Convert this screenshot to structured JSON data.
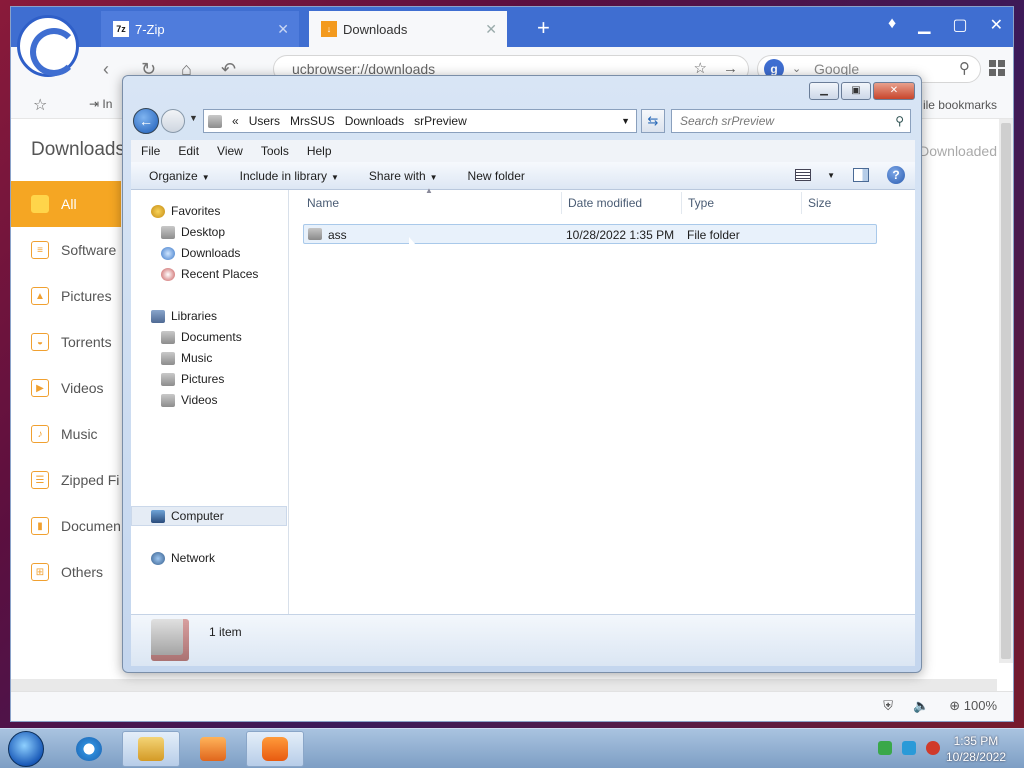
{
  "browser": {
    "tabs": [
      {
        "label": "7-Zip",
        "icon": "7zip-icon",
        "badge": "7z"
      },
      {
        "label": "Downloads",
        "icon": "download-icon"
      }
    ],
    "address": "ucbrowser://downloads",
    "search_placeholder": "Google",
    "bookmark_import_fragment": "In",
    "bookmark_mobile_fragment": "ile bookmarks",
    "page_title": "Downloads",
    "right_header_fragment": "Downloaded",
    "sidebar": [
      {
        "label": "All",
        "active": true
      },
      {
        "label": "Software"
      },
      {
        "label": "Pictures"
      },
      {
        "label": "Torrents"
      },
      {
        "label": "Videos"
      },
      {
        "label": "Music"
      },
      {
        "label": "Zipped Fi"
      },
      {
        "label": "Documen"
      },
      {
        "label": "Others"
      }
    ],
    "zoom": "100%"
  },
  "explorer": {
    "breadcrumb": [
      "«",
      "Users",
      "MrsSUS",
      "Downloads",
      "srPreview"
    ],
    "search_placeholder": "Search srPreview",
    "menu": [
      "File",
      "Edit",
      "View",
      "Tools",
      "Help"
    ],
    "commands": [
      "Organize",
      "Include in library",
      "Share with",
      "New folder"
    ],
    "nav": {
      "favorites": "Favorites",
      "desktop": "Desktop",
      "downloads": "Downloads",
      "recent": "Recent Places",
      "libraries": "Libraries",
      "documents": "Documents",
      "music": "Music",
      "pictures": "Pictures",
      "videos": "Videos",
      "computer": "Computer",
      "network": "Network"
    },
    "columns": [
      "Name",
      "Date modified",
      "Type",
      "Size"
    ],
    "files": [
      {
        "name": "ass",
        "date": "10/28/2022 1:35 PM",
        "type": "File folder",
        "size": ""
      }
    ],
    "status": "1 item"
  },
  "taskbar": {
    "time": "1:35 PM",
    "date": "10/28/2022"
  },
  "colors": {
    "accent": "#3f6ed1",
    "sidebar_active": "#f5a623"
  }
}
